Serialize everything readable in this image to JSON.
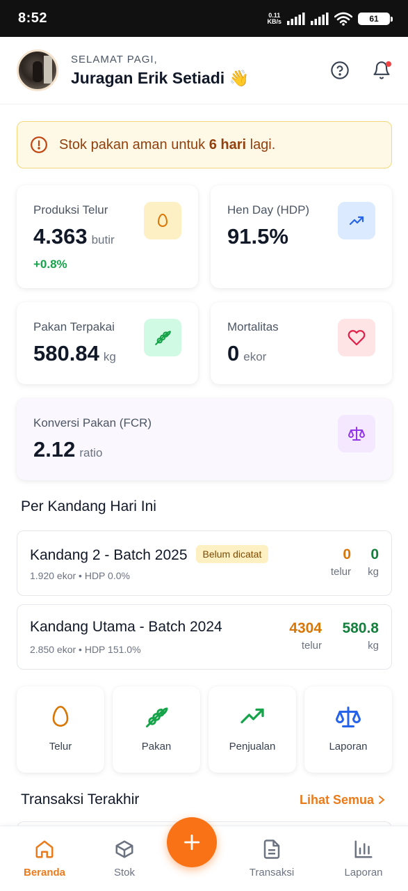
{
  "status_bar": {
    "time": "8:52",
    "net_speed_value": "0.11",
    "net_speed_unit": "KB/s",
    "battery": "61"
  },
  "header": {
    "greeting": "SELAMAT PAGI,",
    "user_name": "Juragan Erik Setiadi 👋",
    "help_icon": "help-circle-icon",
    "notification_icon": "bell-icon"
  },
  "alert": {
    "prefix": "Stok pakan aman untuk ",
    "highlight": "6 hari",
    "suffix": " lagi."
  },
  "stats": {
    "produksi": {
      "label": "Produksi Telur",
      "value": "4.363",
      "unit": "butir",
      "delta": "+0.8%",
      "icon": "egg-icon",
      "icon_bg": "#fdf0c4",
      "icon_color": "#d97706"
    },
    "hdp": {
      "label": "Hen Day (HDP)",
      "value": "91.5%",
      "icon": "trending-up-icon",
      "icon_bg": "#dbeafe",
      "icon_color": "#2563eb"
    },
    "pakan": {
      "label": "Pakan Terpakai",
      "value": "580.84",
      "unit": "kg",
      "icon": "wheat-icon",
      "icon_bg": "#d1fae5",
      "icon_color": "#16a34a"
    },
    "mortalitas": {
      "label": "Mortalitas",
      "value": "0",
      "unit": "ekor",
      "icon": "heart-icon",
      "icon_bg": "#ffe4e6",
      "icon_color": "#e11d48"
    },
    "fcr": {
      "label": "Konversi Pakan (FCR)",
      "value": "2.12",
      "unit": "ratio",
      "icon": "scale-icon",
      "icon_bg": "#f3e8ff",
      "icon_color": "#9333ea"
    }
  },
  "per_kandang": {
    "title": "Per Kandang Hari Ini",
    "items": [
      {
        "name": "Kandang 2 - Batch 2025",
        "badge": "Belum dicatat",
        "sub": "1.920 ekor • HDP 0.0%",
        "telur": "0",
        "telur_unit": "telur",
        "kg": "0",
        "kg_unit": "kg"
      },
      {
        "name": "Kandang Utama - Batch 2024",
        "sub": "2.850 ekor • HDP 151.0%",
        "telur": "4304",
        "telur_unit": "telur",
        "kg": "580.8",
        "kg_unit": "kg"
      }
    ]
  },
  "quick_actions": [
    {
      "label": "Telur",
      "icon": "egg-icon"
    },
    {
      "label": "Pakan",
      "icon": "wheat-icon"
    },
    {
      "label": "Penjualan",
      "icon": "trending-up-icon"
    },
    {
      "label": "Laporan",
      "icon": "scale-icon"
    }
  ],
  "transaksi": {
    "title": "Transaksi Terakhir",
    "see_all": "Lihat Semua"
  },
  "bottom_nav": {
    "items": [
      {
        "label": "Beranda",
        "icon": "home-icon",
        "active": true
      },
      {
        "label": "Stok",
        "icon": "box-icon"
      },
      {
        "label": "Transaksi",
        "icon": "document-icon"
      },
      {
        "label": "Laporan",
        "icon": "bar-chart-icon"
      }
    ],
    "fab_icon": "plus-icon"
  },
  "colors": {
    "accent": "#f97316",
    "accent_text": "#ea7a1a",
    "positive": "#16a34a"
  }
}
